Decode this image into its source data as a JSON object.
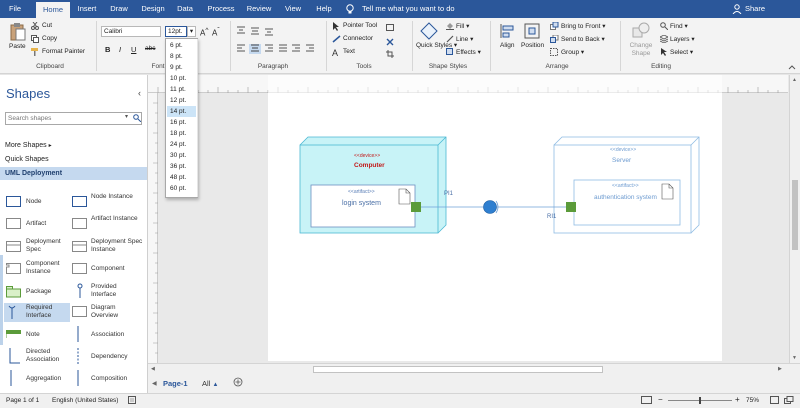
{
  "tabs": [
    "File",
    "Home",
    "Insert",
    "Draw",
    "Design",
    "Data",
    "Process",
    "Review",
    "View",
    "Help"
  ],
  "tell_me": "Tell me what you want to do",
  "share": "Share",
  "clipboard": {
    "paste": "Paste",
    "cut": "Cut",
    "copy": "Copy",
    "format_painter": "Format Painter",
    "label": "Clipboard"
  },
  "font": {
    "name": "Calibri",
    "size": "12pt.",
    "label": "Font",
    "abc": "abc"
  },
  "font_sizes": [
    "6 pt.",
    "8 pt.",
    "9 pt.",
    "10 pt.",
    "11 pt.",
    "12 pt.",
    "14 pt.",
    "16 pt.",
    "18 pt.",
    "24 pt.",
    "30 pt.",
    "36 pt.",
    "48 pt.",
    "60 pt."
  ],
  "font_size_highlighted": "14 pt.",
  "paragraph": {
    "label": "Paragraph"
  },
  "tools": {
    "pointer": "Pointer Tool",
    "connector": "Connector",
    "text": "Text",
    "label": "Tools"
  },
  "shape_styles": {
    "quick_styles": "Quick Styles",
    "fill": "Fill",
    "line": "Line",
    "effects": "Effects",
    "label": "Shape Styles"
  },
  "arrange": {
    "align": "Align",
    "position": "Position",
    "bring_front": "Bring to Front",
    "send_back": "Send to Back",
    "group": "Group",
    "label": "Arrange"
  },
  "editing": {
    "change_shape": "Change Shape",
    "find": "Find",
    "layers": "Layers",
    "select": "Select",
    "label": "Editing"
  },
  "shapes_panel": {
    "title": "Shapes",
    "search_placeholder": "Search shapes",
    "more_shapes": "More Shapes",
    "quick_shapes": "Quick Shapes",
    "uml_deployment": "UML Deployment",
    "items": [
      [
        "Node",
        "Node Instance"
      ],
      [
        "Artifact",
        "Artifact Instance"
      ],
      [
        "Deployment Spec",
        "Deployment Spec Instance"
      ],
      [
        "Component Instance",
        "Component"
      ],
      [
        "Package",
        "Provided Interface"
      ],
      [
        "Required Interface",
        "Diagram Overview"
      ],
      [
        "Note",
        "Association"
      ],
      [
        "Directed Association",
        "Dependency"
      ],
      [
        "Aggregation",
        "Composition"
      ]
    ]
  },
  "diagram": {
    "device_tag": "<<device>>",
    "artifact_tag": "<<artifact>>",
    "computer": "Computer",
    "server": "Server",
    "login": "login system",
    "auth": "authentication system",
    "pi1": "PI1",
    "ri1": "RI1"
  },
  "page_tabs": {
    "page1": "Page-1",
    "all": "All"
  },
  "status": {
    "page": "Page 1 of 1",
    "lang": "English (United States)",
    "zoom": "75%"
  },
  "colors": {
    "accent": "#2b579a",
    "node_fill": "#c8f3f7",
    "node_border": "#4bb8d3",
    "port": "#5b9b3a",
    "interface": "#2f7fd0"
  }
}
